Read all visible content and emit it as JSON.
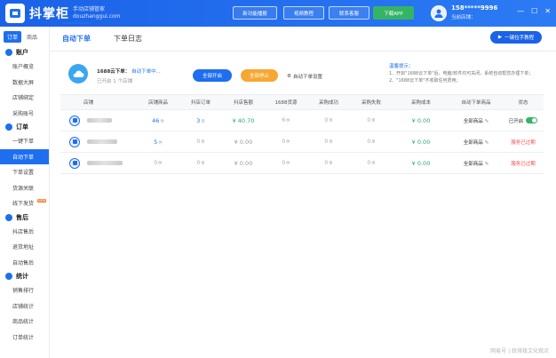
{
  "header": {
    "app_name": "抖掌柜",
    "app_sub_line1": "手动店铺管家",
    "app_sub_line2": "douzhanggui.com",
    "buttons": [
      {
        "label": "新功能播报"
      },
      {
        "label": "视频教程"
      },
      {
        "label": "联系客服"
      },
      {
        "label": "下载APP"
      }
    ],
    "user_phone": "158*****9996",
    "user_shop": "当前店铺："
  },
  "sidebar": {
    "tabs": [
      "订单",
      "商品"
    ],
    "sections": [
      {
        "title": "账户",
        "items": [
          "账户概览",
          "数据大屏",
          "店铺绑定",
          "采购账号"
        ]
      },
      {
        "title": "订单",
        "items": [
          "一键下单",
          "自动下单",
          "下单设置",
          "货源关联",
          "线下发货"
        ]
      },
      {
        "title": "售后",
        "items": [
          "抖店售后",
          "退货地址",
          "自动售后"
        ]
      },
      {
        "title": "统计",
        "items": [
          "销售排行",
          "店铺统计",
          "商品统计",
          "订单统计"
        ]
      }
    ],
    "new_badge": "NEW"
  },
  "main": {
    "tabs": [
      "自动下单",
      "下单日志"
    ],
    "guide_button": "一键拉手教程"
  },
  "card": {
    "title_prefix": "1688云下单：",
    "title_link": "自动下单中...",
    "subtitle": "已开启 1 个店铺",
    "btn_start": "全部开启",
    "btn_stop": "全部停止",
    "setting_label": "自动下单设置",
    "tips_title": "温馨提示：",
    "tips_line1": "1、开启\"1688云下单\"后，电脑/软件均可关闭，系统自动帮您办理下单；",
    "tips_line2": "2、\"1688云下单\"不收取任何费用；"
  },
  "table": {
    "headers": [
      "店铺",
      "店铺商品",
      "抖店订单",
      "抖店售额",
      "1688货源",
      "采购成功",
      "采购失败",
      "采购成本",
      "自动下单商品",
      "状态"
    ],
    "unit_item": "件",
    "unit_order": "单",
    "rows": [
      {
        "goods": "46",
        "orders": "3",
        "sales": "¥ 40.70",
        "source": "6",
        "success": "0",
        "fail": "0",
        "cost": "¥ 0.00",
        "auto": "全部商品",
        "status": "已开启",
        "status_type": "on"
      },
      {
        "goods": "5",
        "orders": "0",
        "sales": "¥ 0.00",
        "source": "0",
        "success": "0",
        "fail": "0",
        "cost": "¥ 0.00",
        "auto": "全部商品",
        "status": "服务已过期",
        "status_type": "expired"
      },
      {
        "goods": "0",
        "orders": "0",
        "sales": "¥ 0.00",
        "source": "0",
        "success": "0",
        "fail": "0",
        "cost": "¥ 0.00",
        "auto": "全部商品",
        "status": "服务已过期",
        "status_type": "expired"
      }
    ]
  },
  "watermark": "网易号 | 跃境极文化观点"
}
